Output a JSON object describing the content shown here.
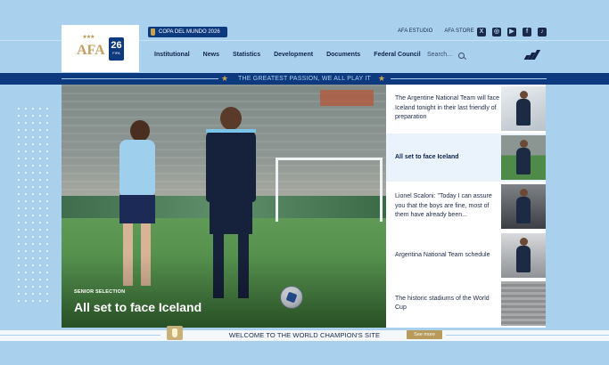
{
  "header": {
    "badge_label": "COPA DEL MUNDO 2026",
    "crest_text": "AFA",
    "fifa_badge_text": "FIFA",
    "top_links": [
      "AFA ESTUDIO",
      "AFA STORE"
    ],
    "social_icons": [
      "x-icon",
      "instagram-icon",
      "youtube-icon",
      "facebook-icon",
      "tiktok-icon"
    ]
  },
  "nav": {
    "items": [
      "Institutional",
      "News",
      "Statistics",
      "Development",
      "Documents",
      "Federal Council"
    ],
    "search_placeholder": "Search..."
  },
  "slogan": "THE GREATEST PASSION, WE ALL PLAY IT",
  "hero": {
    "category": "SENIOR SELECTION",
    "title": "All set to face Iceland"
  },
  "news": [
    {
      "title": "The Argentine National Team will face Iceland tonight in their last friendly of preparation",
      "active": false
    },
    {
      "title": "All set to face Iceland",
      "active": true
    },
    {
      "title": "Lionel Scaloni: \"Today I can assure you that the boys are fine, most of them have already been...",
      "active": false
    },
    {
      "title": "Argentina National Team schedule",
      "active": false
    },
    {
      "title": "The historic stadiums of the World Cup",
      "active": false
    }
  ],
  "footer": {
    "welcome": "WELCOME TO THE WORLD CHAMPION'S SITE",
    "see_more": "See more"
  },
  "colors": {
    "sky": "#a9d1ee",
    "navy": "#0d3a7e",
    "gold": "#c9a350"
  }
}
